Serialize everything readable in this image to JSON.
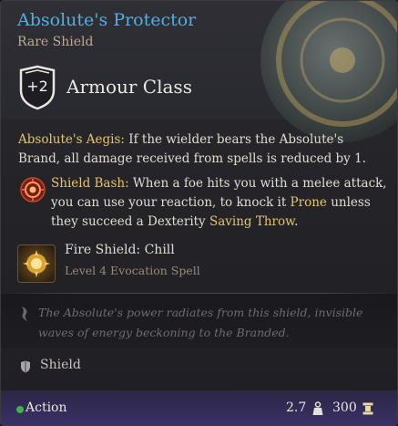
{
  "item": {
    "name": "Absolute's Protector",
    "rarity_type": "Rare Shield",
    "armour_class_bonus": "+2",
    "armour_class_label": "Armour Class"
  },
  "aegis": {
    "name": "Absolute's Aegis:",
    "text": " If the wielder bears the Absolute's Brand, all damage received from spells is reduced by 1."
  },
  "shield_bash": {
    "icon": "shield-bash-icon",
    "name": "Shield Bash:",
    "text_before": " When a foe hits you with a melee attack, you can use your reaction, to knock it ",
    "prone": "Prone",
    "text_middle": " unless they succeed a Dexterity ",
    "saving_throw": "Saving Throw",
    "text_end": "."
  },
  "spell": {
    "icon": "fire-shield-icon",
    "name": "Fire Shield: Chill",
    "level": "Level 4 Evocation Spell"
  },
  "lore": "The Absolute's power radiates from this shield, invisible waves of energy beckoning to the Branded.",
  "item_type": {
    "icon": "shield-icon",
    "label": "Shield"
  },
  "footer": {
    "action_label": "Action",
    "weight": "2.7",
    "weight_icon": "weight-icon",
    "value": "300",
    "value_icon": "gold-icon"
  },
  "colors": {
    "title": "#52aee3",
    "keyword": "#e6c46a",
    "action_dot": "#3fb24a",
    "footer": "#3a3068"
  }
}
